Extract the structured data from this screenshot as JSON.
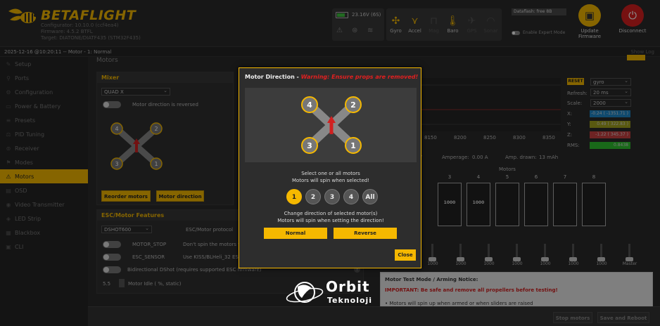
{
  "header": {
    "brand": "BETAFLIGHT",
    "configurator": "Configurator: 10.10.0 (ccf4ea4)",
    "firmware": "Firmware: 4.5.2 BTFL",
    "target": "Target: DIATONE/DIATF435 (STM32F435)",
    "battery_voltage": "23.16V (6S)",
    "sensors": [
      {
        "label": "Gyro",
        "icon": "gyro-icon",
        "active": true
      },
      {
        "label": "Accel",
        "icon": "accel-icon",
        "active": true
      },
      {
        "label": "Mag",
        "icon": "mag-icon",
        "active": false
      },
      {
        "label": "Baro",
        "icon": "baro-icon",
        "active": true
      },
      {
        "label": "GPS",
        "icon": "gps-icon",
        "active": false
      },
      {
        "label": "Sonar",
        "icon": "sonar-icon",
        "active": false
      }
    ],
    "dataflash": "Dataflash: free 8B",
    "expert_mode": "Enable Expert Mode",
    "update_firmware": "Update Firmware",
    "disconnect": "Disconnect"
  },
  "statusbar": {
    "text": "2025-12-16 @10:20:11 -- Motor - 1: Normal",
    "show_log": "Show Log"
  },
  "sidebar": {
    "items": [
      {
        "label": "Setup",
        "icon": "wrench-icon",
        "active": false
      },
      {
        "label": "Ports",
        "icon": "plug-icon",
        "active": false
      },
      {
        "label": "Configuration",
        "icon": "gear-icon",
        "active": false
      },
      {
        "label": "Power & Battery",
        "icon": "battery-icon",
        "active": false
      },
      {
        "label": "Presets",
        "icon": "presets-icon",
        "active": false
      },
      {
        "label": "PID Tuning",
        "icon": "tuning-icon",
        "active": false
      },
      {
        "label": "Receiver",
        "icon": "receiver-icon",
        "active": false
      },
      {
        "label": "Modes",
        "icon": "modes-icon",
        "active": false
      },
      {
        "label": "Motors",
        "icon": "motors-icon",
        "active": true
      },
      {
        "label": "OSD",
        "icon": "osd-icon",
        "active": false
      },
      {
        "label": "Video Transmitter",
        "icon": "vtx-icon",
        "active": false
      },
      {
        "label": "LED Strip",
        "icon": "led-icon",
        "active": false
      },
      {
        "label": "Blackbox",
        "icon": "blackbox-icon",
        "active": false
      },
      {
        "label": "CLI",
        "icon": "cli-icon",
        "active": false
      }
    ]
  },
  "main": {
    "title": "Motors",
    "mixer": {
      "heading": "Mixer",
      "type": "QUAD X",
      "reversed_label": "Motor direction is reversed",
      "reorder_button": "Reorder motors",
      "direction_button": "Motor direction"
    },
    "esc": {
      "heading": "ESC/Motor Features",
      "protocol_value": "DSHOT600",
      "protocol_label": "ESC/Motor protocol",
      "motor_stop": "MOTOR_STOP",
      "motor_stop_desc": "Don't spin the motors wh",
      "esc_sensor": "ESC_SENSOR",
      "esc_sensor_desc": "Use KISS/BLHeli_32 ESC t",
      "bidir": "Bidirectional DShot (requires supported ESC firmware)",
      "idle_value": "5.5",
      "idle_label": "Motor Idle ( %, static)"
    },
    "graph": {
      "ticks": [
        "8150",
        "8200",
        "8250",
        "8300",
        "8350"
      ],
      "reset": "RESET",
      "source": "gyro",
      "refresh_label": "Refresh:",
      "refresh_value": "20 ms",
      "scale_label": "Scale:",
      "scale_value": "2000",
      "x_label": "X:",
      "x_value": "-0.24 ( -1351.71 )",
      "x_color": "#1e88c8",
      "y_label": "Y:",
      "y_value": "0.49 ( 322.83 )",
      "y_color": "#a3a31e",
      "z_label": "Z:",
      "z_value": "-1.22 ( 345.37 )",
      "z_color": "#c84040",
      "rms_label": "RMS:",
      "rms_value": "0.8438",
      "rms_color": "#2ebf2e"
    },
    "amps": {
      "voltage_suffix": "V",
      "amperage_label": "Amperage:",
      "amperage_value": "0.00 A",
      "drawn_label": "Amp. drawn:",
      "drawn_value": "13 mAh"
    },
    "motors_label": "Motors",
    "motors": [
      {
        "num": "3",
        "value": "1000"
      },
      {
        "num": "4",
        "value": "1000"
      },
      {
        "num": "5",
        "value": ""
      },
      {
        "num": "6",
        "value": ""
      },
      {
        "num": "7",
        "value": ""
      },
      {
        "num": "8",
        "value": ""
      }
    ],
    "slider_values": [
      "1000",
      "1000",
      "1000",
      "1000",
      "1000",
      "1000",
      "1000",
      "Master"
    ],
    "notice": {
      "heading": "Motor Test Mode / Arming Notice:",
      "warning": "IMPORTANT: Be safe and remove all propellers before testing!",
      "line1": "• Motors will spin up when armed or when sliders are raised"
    },
    "stop_motors": "Stop motors",
    "save_reboot": "Save and Reboot"
  },
  "dialog": {
    "title": "Motor Direction - ",
    "warning": "Warning: Ensure props are removed!",
    "motor_labels": [
      "1",
      "2",
      "3",
      "4"
    ],
    "select_line1": "Select one or all motors",
    "select_line2": "Motors will spin when selected!",
    "buttons": [
      "1",
      "2",
      "3",
      "4",
      "All"
    ],
    "selected": "1",
    "change_line1": "Change direction of selected motor(s)",
    "change_line2": "Motors will spin when setting the direction!",
    "normal": "Normal",
    "reverse": "Reverse",
    "close": "Close"
  },
  "watermark": {
    "line1": "Orbit",
    "line2": "Teknoloji"
  }
}
